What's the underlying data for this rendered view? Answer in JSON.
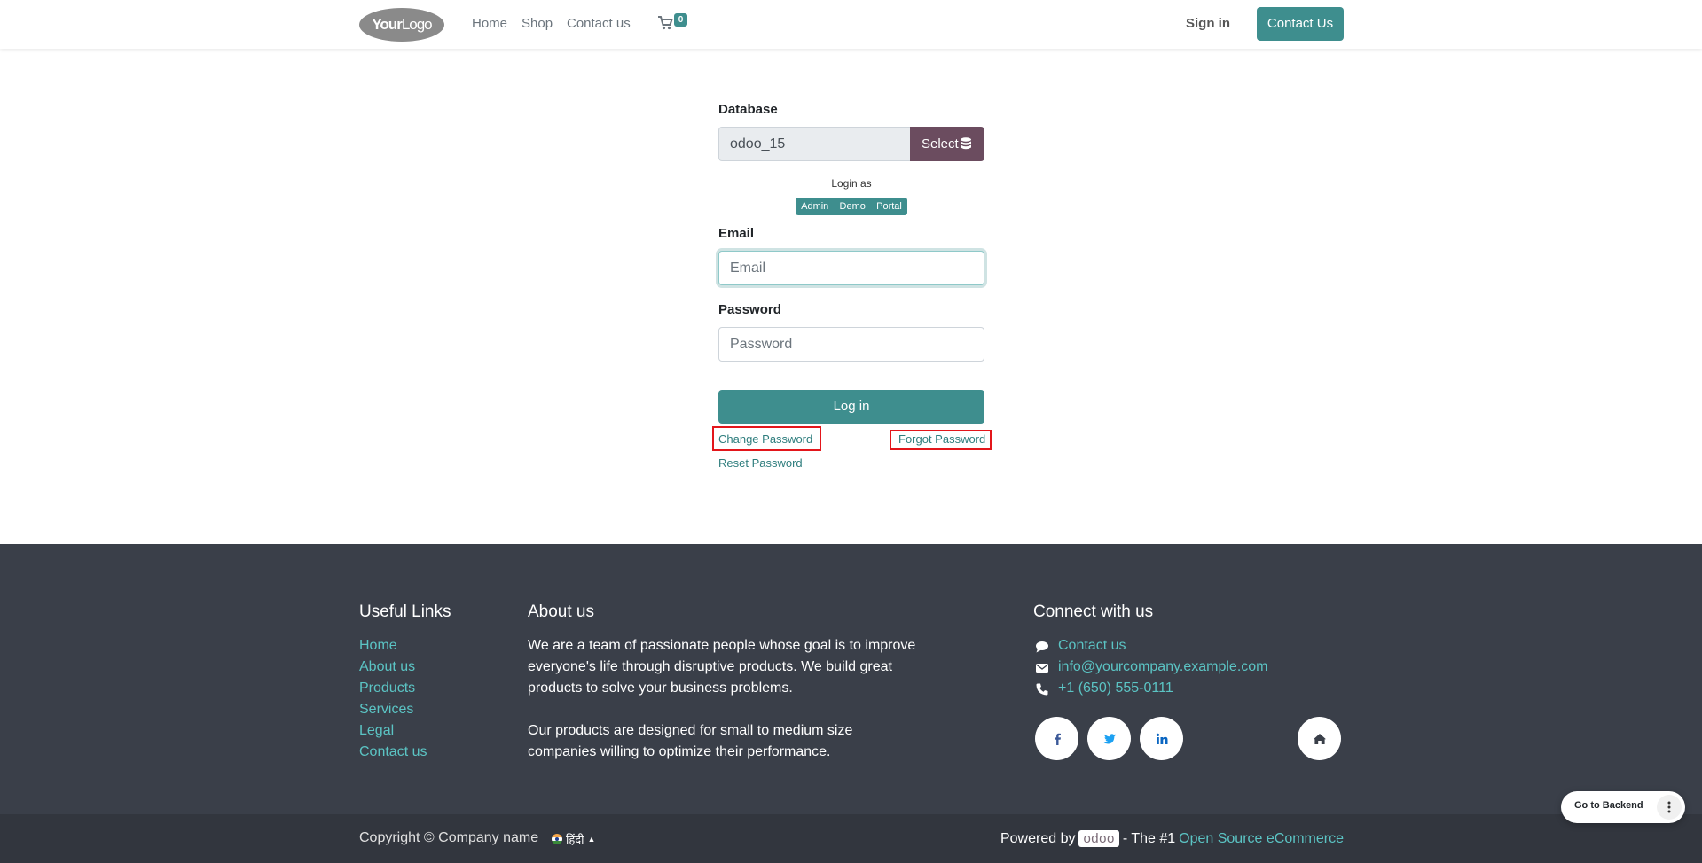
{
  "header": {
    "logo": {
      "bold": "Your",
      "light": "Logo"
    },
    "nav": [
      "Home",
      "Shop",
      "Contact us"
    ],
    "cart_count": "0",
    "sign_in": "Sign in",
    "contact_button": "Contact Us",
    "accent_color": "#3e8e8e"
  },
  "login": {
    "database_label": "Database",
    "database_value": "odoo_15",
    "select_label": "Select",
    "login_as": "Login as",
    "quick_logins": [
      "Admin",
      "Demo",
      "Portal"
    ],
    "email_label": "Email",
    "email_placeholder": "Email",
    "password_label": "Password",
    "password_placeholder": "Password",
    "login_button": "Log in",
    "change_password": "Change Password",
    "forgot_password": "Forgot Password",
    "reset_password": "Reset Password"
  },
  "footer": {
    "useful_links_title": "Useful Links",
    "useful_links": [
      "Home",
      "About us",
      "Products",
      "Services",
      "Legal",
      "Contact us"
    ],
    "about_title": "About us",
    "about_lines_1": [
      "We are a team of passionate people whose goal is to improve",
      "everyone's life through disruptive products. We build great",
      "products to solve your business problems."
    ],
    "about_lines_2": [
      "Our products are designed for small to medium size",
      "companies willing to optimize their performance."
    ],
    "connect_title": "Connect with us",
    "connect_contact": "Contact us",
    "connect_email": "info@yourcompany.example.com",
    "connect_phone": "+1 (650) 555-0111",
    "social_icons": [
      "facebook-icon",
      "twitter-icon",
      "linkedin-icon",
      "home-icon"
    ],
    "background": "#3a3f49"
  },
  "copyright": {
    "text": "Copyright © Company name",
    "language": "हिंदी",
    "powered_by": "Powered by",
    "odoo": "odoo",
    "the_1": "- The #1",
    "open_source": "Open Source eCommerce"
  },
  "backend": {
    "label": "Go to Backend"
  }
}
